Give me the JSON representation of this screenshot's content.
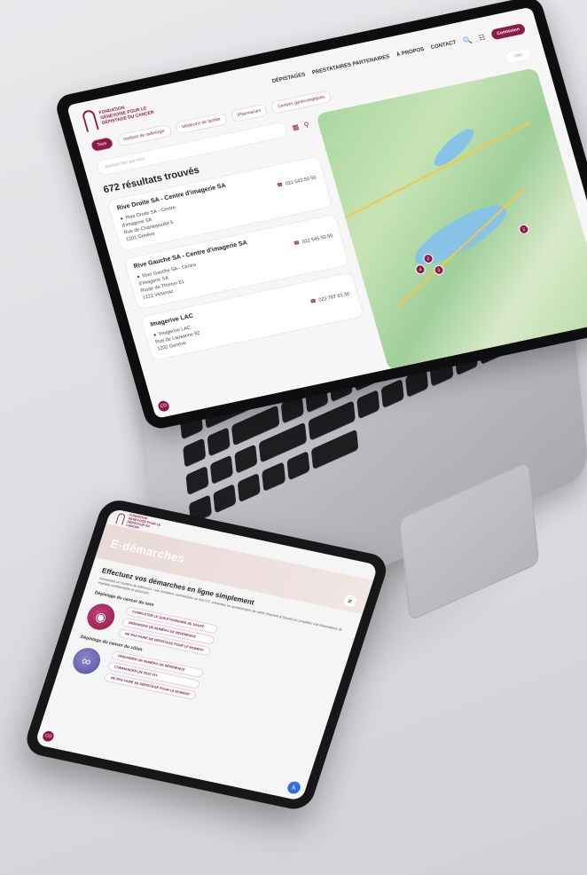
{
  "laptop": {
    "logo_text": "FONDATION GENEVOISE POUR LE DÉPISTAGE DU CANCER",
    "nav": [
      "DÉPISTAGES",
      "PRESTATAIRES PARTENAIRES",
      "À PROPOS",
      "CONTACT"
    ],
    "connect_button": "Connexion",
    "filters": [
      "Tous",
      "Instituts de radiologie",
      "Médecins de famille",
      "Pharmacies",
      "Centres gynécologiques"
    ],
    "location_placeholder": "Ville",
    "search_placeholder": "Rechercher par nom",
    "results_count": "672 résultats trouvés",
    "results": [
      {
        "title": "Rive Droite SA - Centre d'imagerie SA",
        "address": [
          "Rive Droite SA - Centre",
          "d'imagerie SA",
          "Rue de Chantepoulet 5",
          "1201 Genève"
        ],
        "phone": "022 543 50 50"
      },
      {
        "title": "Rive Gauche SA - Centre d'imagerie SA",
        "address": [
          "Rive Gauche SA - Centre",
          "d'imagerie SA",
          "Route de Thonon 61",
          "1222 Vésenaz"
        ],
        "phone": "022 545 50 55"
      },
      {
        "title": "Imagerive LAC",
        "address": [
          "Imagerive LAC",
          "Rue de Lausanne 82",
          "1202 Genève"
        ],
        "phone": "022 787 61 30"
      }
    ],
    "map_marker_labels": [
      "4",
      "2",
      "3",
      "2"
    ],
    "chat_badge": "CO"
  },
  "tablet": {
    "logo_text": "FONDATION GENEVOISE POUR LE DÉPISTAGE DU CANCER",
    "banner_title": "E-démarches",
    "heading": "Effectuez vos démarches en ligne simplement",
    "intro": "Demandez un numéro de référence / une invitation, commandez un test FIT, présentez un questionnaire de santé (imprimé à l'écran) et complétez vos informations de manière confidentielle et sécurisée.",
    "breast_section": "Dépistage du cancer du sein",
    "breast_actions": [
      "COMPLÉTER LE QUESTIONNAIRE DE SANTÉ",
      "DEMANDER UN NUMÉRO DE RÉFÉRENCE",
      "NE PAS FAIRE DE DÉPISTAGE POUR LE MOMENT"
    ],
    "colon_section": "Dépistage du cancer du côlon",
    "colon_actions": [
      "DEMANDER UN NUMÉRO DE RÉFÉRENCE",
      "COMMANDER UN TEST FIT",
      "NE PAS FAIRE DE DÉPISTAGE POUR LE MOMENT"
    ],
    "chat_badge": "CO"
  },
  "colors": {
    "brand": "#8c1b4a",
    "accent_blue": "#2f6fe0",
    "map_green": "#a9d7a0",
    "lake_blue": "#86c3e6"
  }
}
